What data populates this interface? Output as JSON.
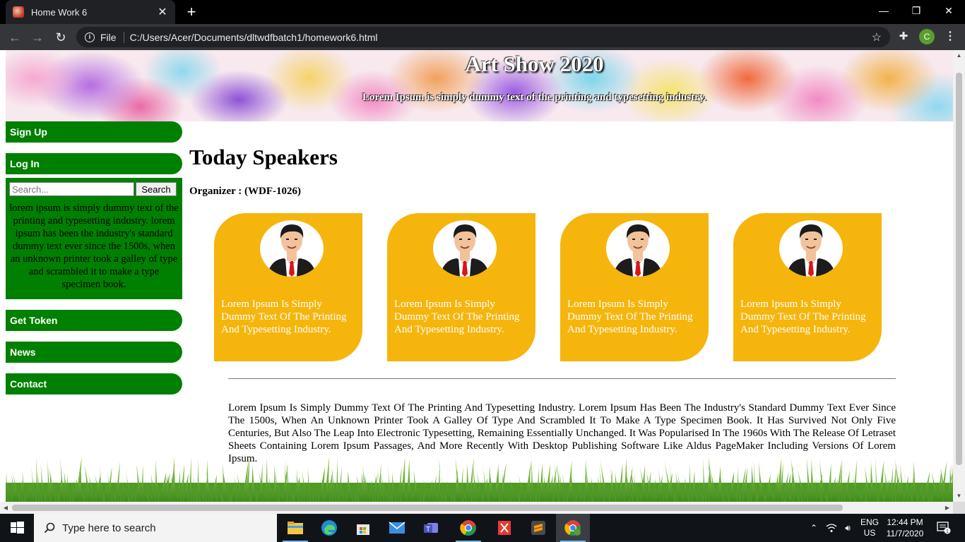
{
  "browser": {
    "tab_title": "Home Work 6",
    "tab_close": "✕",
    "new_tab": "+",
    "window_controls": {
      "minimize": "—",
      "restore": "❐",
      "close": "✕"
    },
    "nav": {
      "back": "←",
      "forward": "→",
      "reload": "↻"
    },
    "scheme_label": "File",
    "url": "C:/Users/Acer/Documents/dltwdfbatch1/homework6.html",
    "bookmark_star": "☆",
    "extensions_icon": "✚",
    "profile_initial": "C",
    "menu": "⋮"
  },
  "page": {
    "header": {
      "title": "Art Show 2020",
      "tagline": "Lorem Ipsum is simply dummy text of the printing and typesetting industry."
    },
    "sidebar": {
      "links_top": [
        "Sign Up",
        "Log In"
      ],
      "search_placeholder": "Search...",
      "search_button": "Search",
      "text": "lorem ipsum is simply dummy text of the printing and typesetting industry. lorem ipsum has been the industry's standard dummy text ever since the 1500s, when an unknown printer took a galley of type and scrambled it to make a type specimen book.",
      "links_bottom": [
        "Get Token",
        "News",
        "Contact"
      ]
    },
    "main": {
      "heading": "Today Speakers",
      "organizer": "Organizer : (WDF-1026)",
      "speakers": [
        {
          "caption": "Lorem Ipsum Is Simply Dummy Text Of The Printing And Typesetting Industry."
        },
        {
          "caption": "Lorem Ipsum Is Simply Dummy Text Of The Printing And Typesetting Industry."
        },
        {
          "caption": "Lorem Ipsum Is Simply Dummy Text Of The Printing And Typesetting Industry."
        },
        {
          "caption": "Lorem Ipsum Is Simply Dummy Text Of The Printing And Typesetting Industry."
        }
      ],
      "paragraph": "Lorem Ipsum Is Simply Dummy Text Of The Printing And Typesetting Industry. Lorem Ipsum Has Been The Industry's Standard Dummy Text Ever Since The 1500s, When An Unknown Printer Took A Galley Of Type And Scrambled It To Make A Type Specimen Book. It Has Survived Not Only Five Centuries, But Also The Leap Into Electronic Typesetting, Remaining Essentially Unchanged. It Was Popularised In The 1960s With The Release Of Letraset Sheets Containing Lorem Ipsum Passages, And More Recently With Desktop Publishing Software Like Aldus PageMaker Including Versions Of Lorem Ipsum."
    },
    "colors": {
      "sidebar_green": "#008000",
      "card_orange": "#f5b50c"
    }
  },
  "taskbar": {
    "search_placeholder": "Type here to search",
    "apps": [
      "file-explorer",
      "edge",
      "microsoft-store",
      "mail",
      "teams",
      "chrome",
      "pdf-reader",
      "sublime-text",
      "chrome-profile"
    ],
    "language": "ENG",
    "region": "US",
    "time": "12:44 PM",
    "date": "11/7/2020",
    "notifications": "1"
  }
}
